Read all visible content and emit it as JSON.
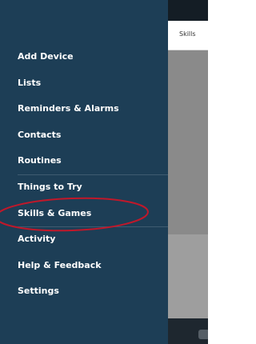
{
  "app_background": {
    "tab_label": "Skills"
  },
  "menu": {
    "items": [
      {
        "label": "Add Device"
      },
      {
        "label": "Lists"
      },
      {
        "label": "Reminders & Alarms"
      },
      {
        "label": "Contacts"
      },
      {
        "label": "Routines"
      },
      {
        "label": "Things to Try"
      },
      {
        "label": "Skills & Games",
        "highlighted": true
      },
      {
        "label": "Activity"
      },
      {
        "label": "Help & Feedback"
      },
      {
        "label": "Settings"
      }
    ]
  },
  "colors": {
    "drawer_bg": "#1d3e56",
    "annotation": "#c0182a",
    "text": "#ffffff"
  }
}
